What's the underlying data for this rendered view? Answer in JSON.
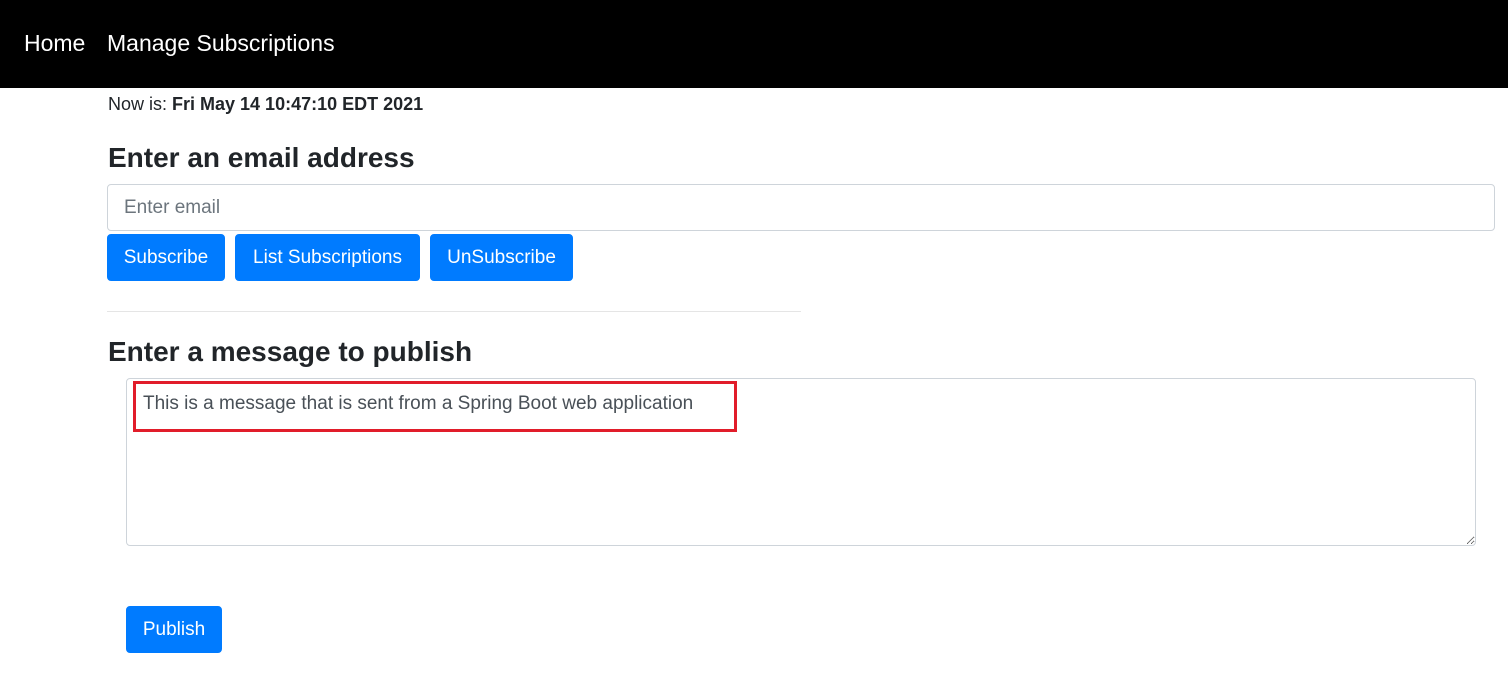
{
  "navbar": {
    "home_label": "Home",
    "manage_label": "Manage Subscriptions"
  },
  "status": {
    "prefix": "Now is: ",
    "datetime": "Fri May 14 10:47:10 EDT 2021"
  },
  "email_section": {
    "heading": "Enter an email address",
    "input_placeholder": "Enter email",
    "input_value": "",
    "subscribe_label": "Subscribe",
    "list_label": "List Subscriptions",
    "unsubscribe_label": "UnSubscribe"
  },
  "message_section": {
    "heading": "Enter a message to publish",
    "message_value": "This is a message that is sent from a Spring Boot web application",
    "publish_label": "Publish"
  },
  "colors": {
    "navbar_bg": "#000000",
    "button_primary": "#007bff",
    "highlight": "#e11d2a"
  }
}
